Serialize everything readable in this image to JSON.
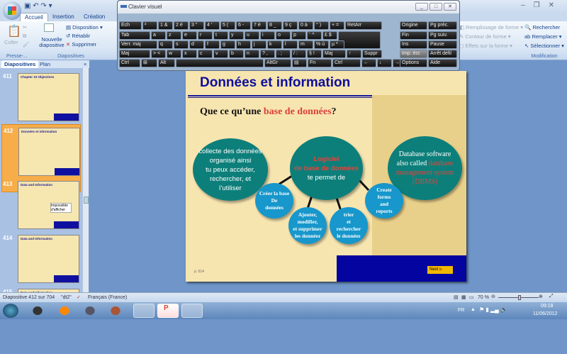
{
  "app": {
    "quick_access": [
      "save",
      "undo",
      "redo"
    ]
  },
  "ribbon": {
    "tabs": [
      "Accueil",
      "Insertion",
      "Création"
    ],
    "active_tab": "Accueil",
    "clipboard": {
      "paste": "Coller",
      "group": "Presse-..."
    },
    "slides": {
      "new_slide": "Nouvelle diapositive",
      "layout": "Disposition",
      "reset": "Rétablir",
      "delete": "Supprimer",
      "group": "Diapositives"
    },
    "drawing": {
      "fill": "Remplissage de forme",
      "outline": "Contour de forme",
      "effects": "Effets sur la forme"
    },
    "editing": {
      "find": "Rechercher",
      "replace": "Remplacer",
      "select": "Sélectionner",
      "group": "Modification"
    }
  },
  "keyboard": {
    "title": "Clavier visuel",
    "rows": [
      [
        "Éch",
        "²",
        "1 &",
        "2 é",
        "3 \"",
        "4 '",
        "5 (",
        "6 -",
        "7 è",
        "8 _",
        "9 ç",
        "0 à",
        "° )",
        "+ =",
        "RetArr"
      ],
      [
        "Tab",
        "a",
        "z",
        "e",
        "r",
        "t",
        "y",
        "u",
        "i",
        "o",
        "p",
        "¨ ^",
        "£ $",
        ""
      ],
      [
        "Verr. maj",
        "q",
        "s",
        "d",
        "f",
        "g",
        "h",
        "j",
        "k",
        "l",
        "m",
        "% ù",
        "µ *"
      ],
      [
        "Maj",
        "> <",
        "w",
        "x",
        "c",
        "v",
        "b",
        "n",
        "? ,",
        ". ;",
        "/ :",
        "§ !",
        "Maj",
        "↑",
        "Suppr"
      ],
      [
        "Ctrl",
        "⊞",
        "Alt",
        "",
        "AltGr",
        "▤",
        "Fn",
        "Ctrl",
        "←",
        "↓",
        "→"
      ]
    ],
    "nav_rows": [
      [
        "Origine",
        "Pg préc."
      ],
      [
        "Fin",
        "Pg suiv."
      ],
      [
        "Ins",
        "Pause"
      ],
      [
        "Imp. écr.",
        "Arrêt défil"
      ],
      [
        "Options",
        "Aide"
      ]
    ]
  },
  "pane": {
    "tabs": [
      "Diapositives",
      "Plan"
    ],
    "thumbnails": [
      {
        "num": "411",
        "title": "Chapter 10 Objectives"
      },
      {
        "num": "412",
        "title": "Données et information",
        "selected": true
      },
      {
        "num": "413",
        "title": "Data and Information",
        "placeholder": "Impossible d'afficher"
      },
      {
        "num": "414",
        "title": "Data and Information"
      },
      {
        "num": "415",
        "title": "Data and Information"
      }
    ]
  },
  "slide": {
    "title": "Données  et  information",
    "subtitle_pre": "Que ce qu’une ",
    "subtitle_red": "base de données",
    "subtitle_post": "?",
    "left_bubble": [
      "collecte des données",
      "organisé ainsi",
      "tu peux accéder,",
      "rechercher, et",
      "l’utiliser"
    ],
    "center_red": [
      "Logiciel",
      "de base de données"
    ],
    "center_white": "te permet   de",
    "right_white": [
      "Database software",
      "also called "
    ],
    "right_red": [
      "database",
      "management system",
      "(DBMS)"
    ],
    "children": [
      [
        "Créer la base",
        "De",
        "données"
      ],
      [
        "Ajouter,",
        "modifier,",
        "et supprimer",
        "les donnéez"
      ],
      [
        "trier",
        "et",
        "rechercher",
        "le donnéez"
      ],
      [
        "Create",
        "forms",
        "and",
        "reports"
      ]
    ],
    "page": "p. 514",
    "next": "Next"
  },
  "status": {
    "slide": "Diapositive 412 sur 704",
    "theme": "\"dt2\"",
    "language": "Français (France)",
    "zoom": "70 %",
    "zoom_percent": 70
  },
  "taskbar": {
    "lang": "FR",
    "time": "09:18",
    "date": "11/06/2012"
  }
}
